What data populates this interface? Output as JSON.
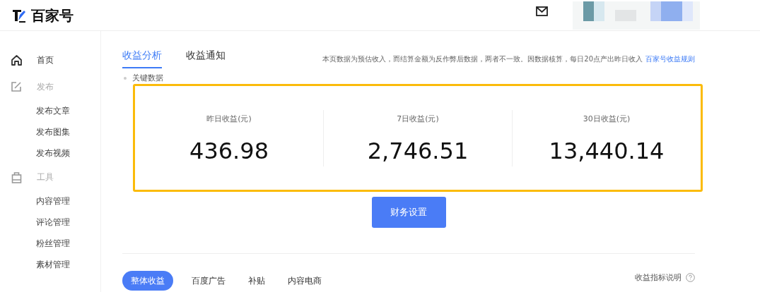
{
  "header": {
    "logo_text": "百家号"
  },
  "sidebar": {
    "items": [
      {
        "kind": "link",
        "label": "首页"
      },
      {
        "kind": "group",
        "label": "发布",
        "children": [
          {
            "label": "发布文章"
          },
          {
            "label": "发布图集"
          },
          {
            "label": "发布视频"
          }
        ]
      },
      {
        "kind": "group",
        "label": "工具",
        "children": [
          {
            "label": "内容管理"
          },
          {
            "label": "评论管理"
          },
          {
            "label": "粉丝管理"
          },
          {
            "label": "素材管理"
          }
        ]
      }
    ]
  },
  "tabs": [
    {
      "label": "收益分析",
      "selected": true
    },
    {
      "label": "收益通知",
      "selected": false
    }
  ],
  "notice": {
    "text": "本页数据为预估收入，而结算金额为反作弊后数据，两者不一致。因数据核算，每日20点产出昨日收入",
    "link": "百家号收益规则"
  },
  "key_data": {
    "label": "关键数据",
    "stats": [
      {
        "label": "昨日收益(元)",
        "value": "436.98"
      },
      {
        "label": "7日收益(元)",
        "value": "2,746.51"
      },
      {
        "label": "30日收益(元)",
        "value": "13,440.14"
      }
    ]
  },
  "finance_button": "财务设置",
  "sub_tabs": [
    {
      "label": "整体收益",
      "selected": true
    },
    {
      "label": "百度广告",
      "selected": false
    },
    {
      "label": "补贴",
      "selected": false
    },
    {
      "label": "内容电商",
      "selected": false
    }
  ],
  "help_link": "收益指标说明"
}
